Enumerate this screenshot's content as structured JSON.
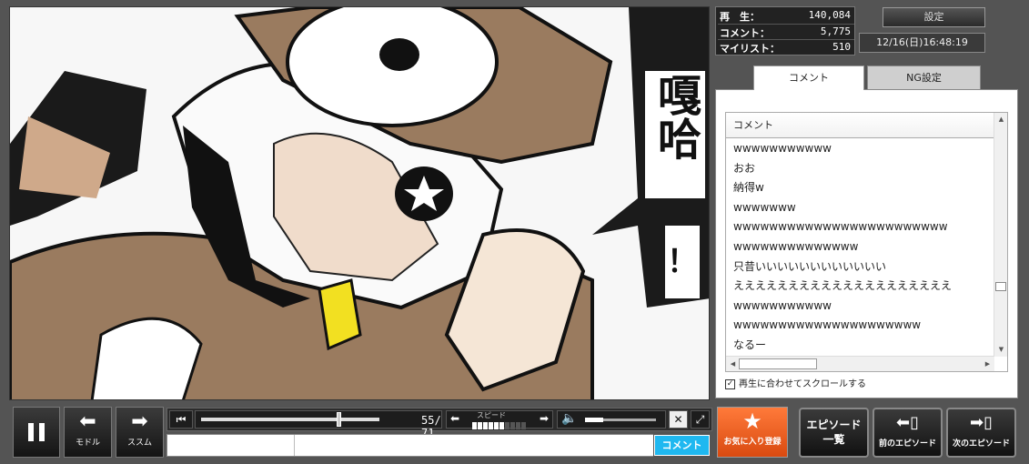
{
  "stats": {
    "views_label": "再　生：",
    "views_value": "140,084",
    "comments_label": "コメント：",
    "comments_value": "5,775",
    "mylist_label": "マイリスト：",
    "mylist_value": "510"
  },
  "settings_label": "設定",
  "datetime": "12/16(日)16:48:19",
  "tabs": {
    "comment": "コメント",
    "ng": "NG設定"
  },
  "comment_list": {
    "header": "コメント",
    "rows": [
      "wwwwwwwwwww",
      "おお",
      "納得w",
      "wwwwwww",
      "wwwwwwwwwwwwwwwwwwwwwwww",
      "wwwwwwwwwwwwww",
      "只昔いいいいいいいいいいいい",
      "ええええええええええええええええええええ",
      "wwwwwwwwwww",
      "wwwwwwwwwwwwwwwwwwwww",
      "なるー"
    ]
  },
  "sync_scroll_label": "再生に合わせてスクロールする",
  "sync_scroll_checked": true,
  "video": {
    "speech_text": "嘎哈",
    "exclaim": "！"
  },
  "controls": {
    "pause_icon": "pause-icon",
    "back_label": "モドル",
    "forward_label": "ススム",
    "time_current": "55",
    "time_total": "71",
    "time_text": "55/ 71",
    "speed_label": "スピード",
    "speed_level": 0.6,
    "seek_position": 0.77,
    "volume_level": 0.25
  },
  "comment_input": {
    "value": "",
    "placeholder": "",
    "submit_label": "コメント"
  },
  "favorite_label": "お気に入り登録",
  "episode_list_label": "エピソード一覧",
  "episode_list_lines": [
    "エピソード",
    "一覧"
  ],
  "prev_episode_label": "前のエピソード",
  "next_episode_label": "次のエピソード",
  "colors": {
    "favorite": "#e8571d",
    "comment_submit": "#1fb8f0"
  }
}
